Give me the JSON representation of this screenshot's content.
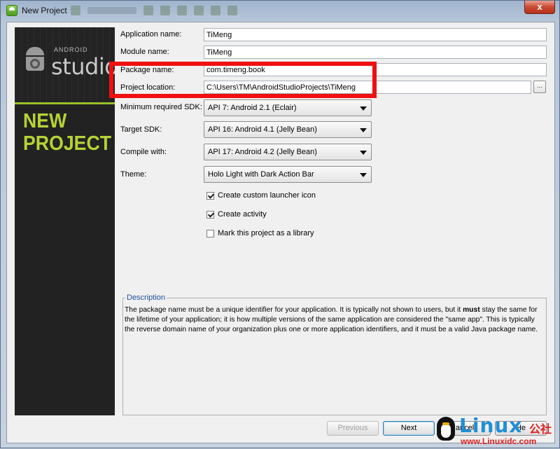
{
  "window": {
    "title": "New Project",
    "close_label": "x"
  },
  "sidebar": {
    "brand_small": "ANDROID",
    "brand_large": "studio",
    "heading_line1": "NEW",
    "heading_line2": "PROJECT"
  },
  "form": {
    "application_name": {
      "label": "Application name:",
      "value": "TiMeng"
    },
    "module_name": {
      "label": "Module name:",
      "value": "TiMeng"
    },
    "package_name": {
      "label": "Package name:",
      "value": "com.timeng.book"
    },
    "project_location": {
      "label": "Project location:",
      "value": "C:\\Users\\TM\\AndroidStudioProjects\\TiMeng",
      "browse_label": "..."
    },
    "min_sdk": {
      "label": "Minimum required SDK:",
      "value": "API 7: Android 2.1 (Eclair)"
    },
    "target_sdk": {
      "label": "Target SDK:",
      "value": "API 16: Android 4.1 (Jelly Bean)"
    },
    "compile_with": {
      "label": "Compile with:",
      "value": "API 17: Android 4.2 (Jelly Bean)"
    },
    "theme": {
      "label": "Theme:",
      "value": "Holo Light with Dark Action Bar"
    },
    "checkboxes": [
      {
        "label": "Create custom launcher icon",
        "checked": true
      },
      {
        "label": "Create activity",
        "checked": true
      },
      {
        "label": "Mark this project as a library",
        "checked": false
      }
    ]
  },
  "annotation": {
    "highlight_color": "#f01010"
  },
  "description": {
    "legend": "Description",
    "text_part1": "The package name must be a unique identifier for your application. It is typically not shown to users, but it ",
    "text_bold": "must",
    "text_part2": " stay the same for the lifetime of your application; it is how multiple versions of the same application are considered the \"same app\". This is typically the reverse domain name of your organization plus one or more application identifiers, and it must be a valid Java package name."
  },
  "buttons": {
    "previous": "Previous",
    "next": "Next",
    "cancel_visible": "ancel",
    "help_visible": "He"
  },
  "watermark": {
    "logo": "Linux",
    "suffix": "公社",
    "url": "www.Linuxidc.com"
  }
}
